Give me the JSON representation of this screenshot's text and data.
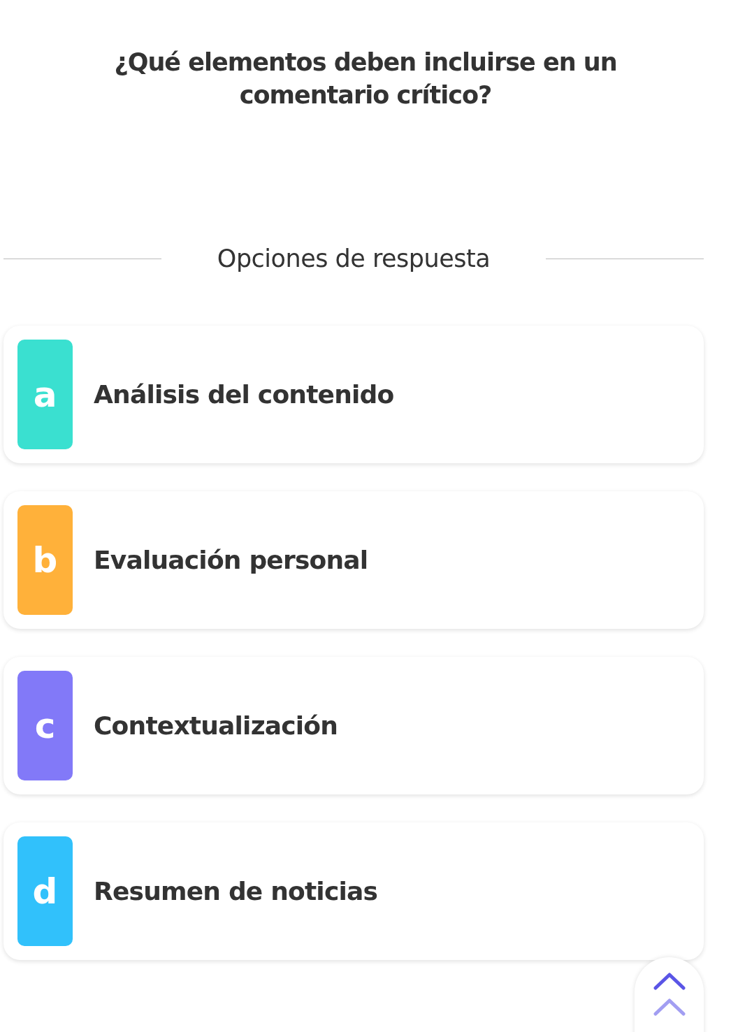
{
  "question": "¿Qué elementos deben incluirse en un comentario crítico?",
  "options_heading": "Opciones de respuesta",
  "options": [
    {
      "letter": "a",
      "text": "Análisis del contenido",
      "color": "#3ae0d0"
    },
    {
      "letter": "b",
      "text": "Evaluación personal",
      "color": "#ffb13a"
    },
    {
      "letter": "c",
      "text": "Contextualización",
      "color": "#8279f8"
    },
    {
      "letter": "d",
      "text": "Resumen de noticias",
      "color": "#31c1fb"
    }
  ]
}
